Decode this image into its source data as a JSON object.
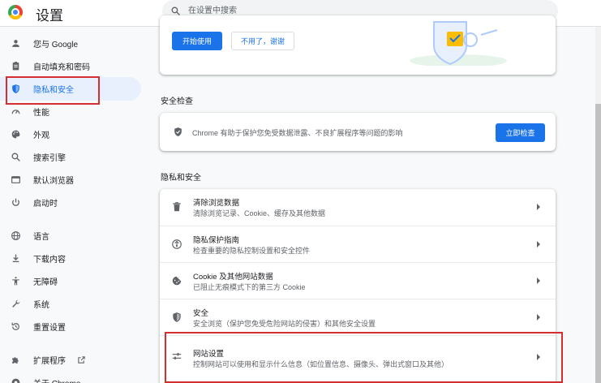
{
  "header": {
    "title": "设置",
    "search_placeholder": "在设置中搜索"
  },
  "sidebar": {
    "items": [
      {
        "label": "您与 Google",
        "icon": "person-icon"
      },
      {
        "label": "自动填充和密码",
        "icon": "clipboard-icon"
      },
      {
        "label": "隐私和安全",
        "icon": "shield-icon",
        "active": true
      },
      {
        "label": "性能",
        "icon": "speedometer-icon"
      },
      {
        "label": "外观",
        "icon": "palette-icon"
      },
      {
        "label": "搜索引擎",
        "icon": "search-icon"
      },
      {
        "label": "默认浏览器",
        "icon": "browser-icon"
      },
      {
        "label": "启动时",
        "icon": "power-icon"
      },
      {
        "label": "语言",
        "icon": "globe-icon"
      },
      {
        "label": "下载内容",
        "icon": "download-icon"
      },
      {
        "label": "无障碍",
        "icon": "accessibility-icon"
      },
      {
        "label": "系统",
        "icon": "wrench-icon"
      },
      {
        "label": "重置设置",
        "icon": "reset-icon"
      },
      {
        "label": "扩展程序",
        "icon": "puzzle-icon"
      },
      {
        "label": "关于 Chrome",
        "icon": "chrome-icon"
      }
    ]
  },
  "promo": {
    "start_button": "开始使用",
    "dismiss_button": "不用了，谢谢"
  },
  "safety_check": {
    "heading": "安全检查",
    "description": "Chrome 有助于保护您免受数据泄露、不良扩展程序等问题的影响",
    "button": "立即检查"
  },
  "privacy": {
    "heading": "隐私和安全",
    "rows": [
      {
        "title": "清除浏览数据",
        "subtitle": "清除浏览记录、Cookie、缓存及其他数据",
        "icon": "trash-icon"
      },
      {
        "title": "隐私保护指南",
        "subtitle": "检查重要的隐私控制设置和安全控件",
        "icon": "guide-icon"
      },
      {
        "title": "Cookie 及其他网站数据",
        "subtitle": "已阻止无痕模式下的第三方 Cookie",
        "icon": "cookie-icon"
      },
      {
        "title": "安全",
        "subtitle": "安全浏览（保护您免受危险网站的侵害）和其他安全设置",
        "icon": "security-shield-icon"
      },
      {
        "title": "网站设置",
        "subtitle": "控制网站可以使用和显示什么信息（如位置信息、摄像头、弹出式窗口及其他）",
        "icon": "sliders-icon"
      }
    ]
  },
  "colors": {
    "accent": "#1a73e8",
    "highlight": "#d32f2f",
    "active_bg": "#e8f0fe"
  }
}
